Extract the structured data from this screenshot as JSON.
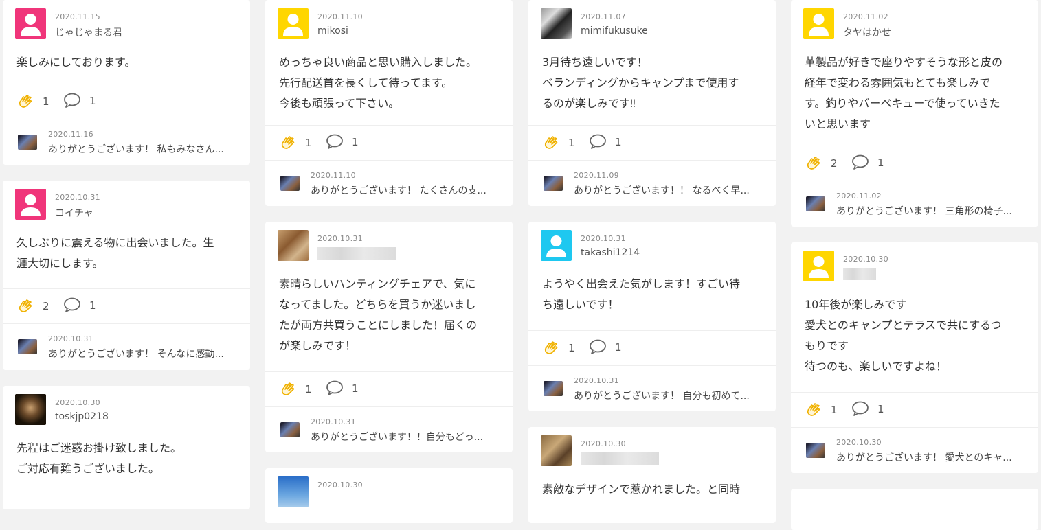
{
  "colors": {
    "pink_avatar": "#f0357a",
    "yellow_avatar": "#ffd600",
    "cyan_avatar": "#1ec8f0",
    "clap_icon": "#f0b100",
    "comment_icon": "#666666"
  },
  "columns": [
    {
      "cards": [
        {
          "date": "2020.11.15",
          "user": "じゃじゃまる君",
          "avatar": "pink",
          "text": "楽しみにしております。",
          "claps": "1",
          "comments": "1",
          "reply": {
            "date": "2020.11.16",
            "text": "ありがとうございます！ 私もみなさん..."
          }
        },
        {
          "date": "2020.10.31",
          "user": "コイチャ",
          "avatar": "pink",
          "text": "久しぶりに震える物に出会いました。生\n涯大切にします。",
          "claps": "2",
          "comments": "1",
          "reply": {
            "date": "2020.10.31",
            "text": "ありがとうございます！ そんなに感動..."
          }
        },
        {
          "date": "2020.10.30",
          "user": "toskjp0218",
          "avatar": "photo-tiger",
          "text": "先程はご迷惑お掛け致しました。\nご対応有難うございました。"
        }
      ]
    },
    {
      "cards": [
        {
          "date": "2020.11.10",
          "user": "mikosi",
          "avatar": "yellow",
          "text": "めっちゃ良い商品と思い購入しました。\n先行配送首を長くして待ってます。\n今後も頑張って下さい。",
          "claps": "1",
          "comments": "1",
          "reply": {
            "date": "2020.11.10",
            "text": "ありがとうございます！ たくさんの支..."
          }
        },
        {
          "date": "2020.10.31",
          "user": "",
          "avatar": "photo-blur",
          "text": "素晴らしいハンティングチェアで、気に\nなってました。どちらを買うか迷いまし\nたが両方共買うことにしました！届くの\nが楽しみです！",
          "claps": "1",
          "comments": "1",
          "reply": {
            "date": "2020.10.31",
            "text": "ありがとうございます！！自分もどっ..."
          }
        },
        {
          "date": "2020.10.30",
          "user": "",
          "avatar": "photo-sky",
          "text": ""
        }
      ]
    },
    {
      "cards": [
        {
          "date": "2020.11.07",
          "user": "mimifukusuke",
          "avatar": "photo-cat",
          "text": "3月待ち遠しいです！\nベランディングからキャンプまで使用す\nるのが楽しみです‼",
          "claps": "1",
          "comments": "1",
          "reply": {
            "date": "2020.11.09",
            "text": "ありがとうございます！！ なるべく早..."
          }
        },
        {
          "date": "2020.10.31",
          "user": "takashi1214",
          "avatar": "cyan",
          "text": "ようやく出会えた気がします！すごい待\nち遠しいです！",
          "claps": "1",
          "comments": "1",
          "reply": {
            "date": "2020.10.31",
            "text": "ありがとうございます！ 自分も初めて..."
          }
        },
        {
          "date": "2020.10.30",
          "user": "",
          "avatar": "photo-blur2",
          "text": "素敵なデザインで惹かれました。と同時"
        }
      ]
    },
    {
      "cards": [
        {
          "date": "2020.11.02",
          "user": "タヤはかせ",
          "avatar": "yellow",
          "text": "革製品が好きで座りやすそうな形と皮の\n経年で変わる雰囲気もとても楽しみで\nす。釣りやバーベキューで使っていきた\nいと思います",
          "claps": "2",
          "comments": "1",
          "reply": {
            "date": "2020.11.02",
            "text": "ありがとうございます！ 三角形の椅子..."
          }
        },
        {
          "date": "2020.10.30",
          "user": "",
          "avatar": "yellow",
          "text": "10年後が楽しみです\n愛犬とのキャンプとテラスで共にするつ\nもりです\n待つのも、楽しいですよね！",
          "claps": "1",
          "comments": "1",
          "reply": {
            "date": "2020.10.30",
            "text": "ありがとうございます！ 愛犬とのキャ..."
          }
        }
      ]
    }
  ]
}
